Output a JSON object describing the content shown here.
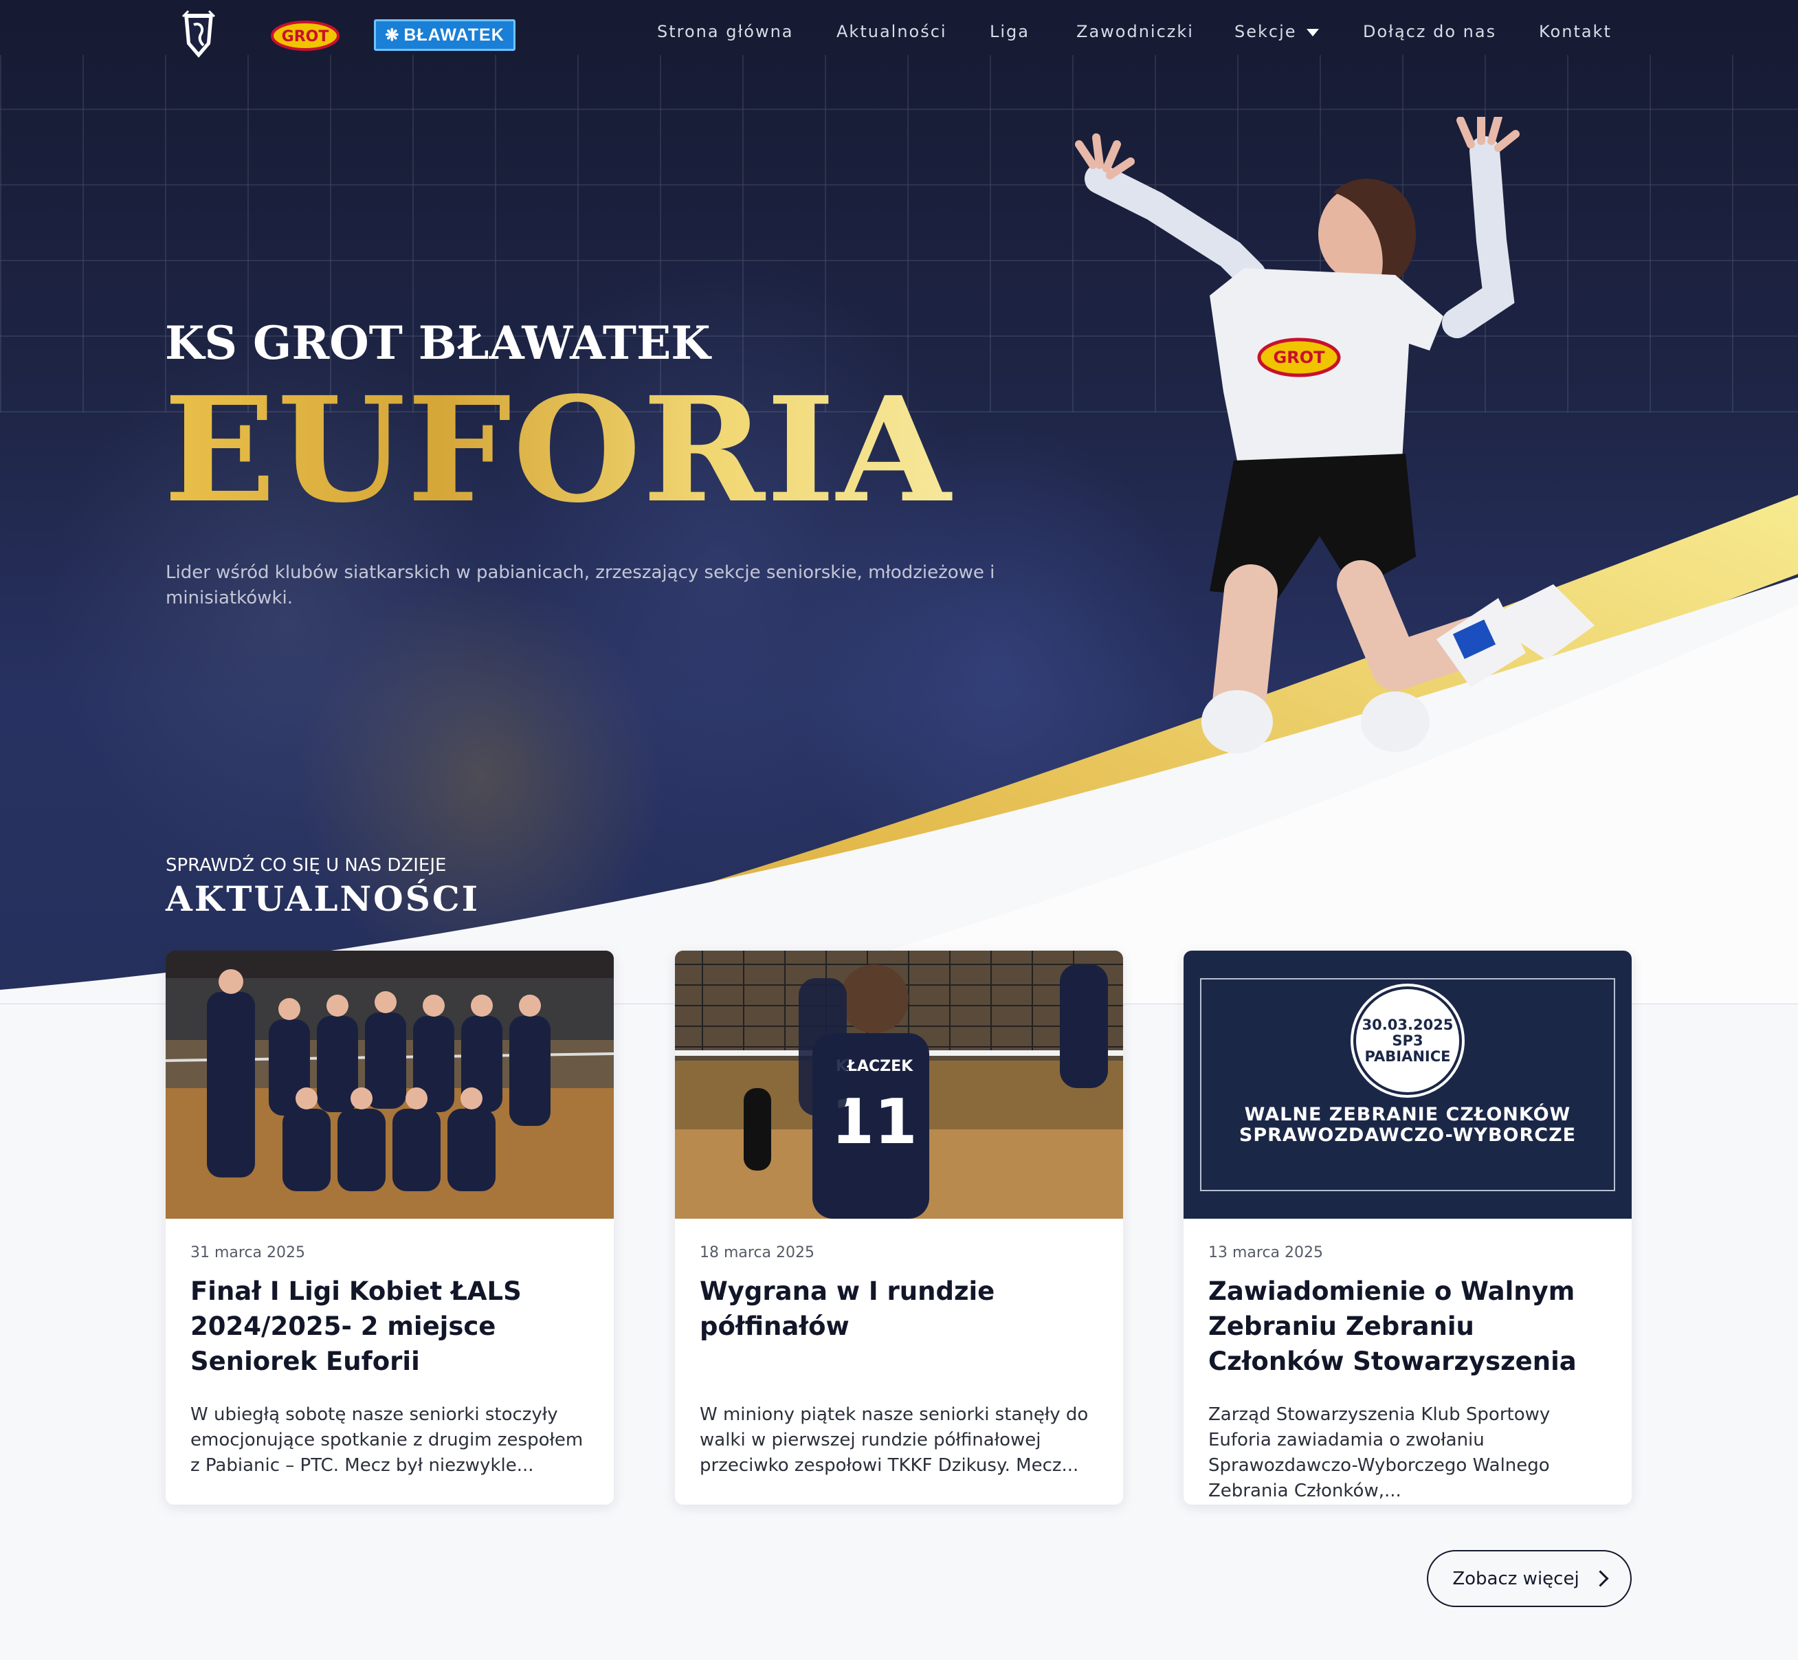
{
  "nav": {
    "logos": {
      "club": "club-crest-logo",
      "grot": "GROT",
      "blawatek": "BŁAWATEK"
    },
    "links": [
      {
        "label": "Strona główna"
      },
      {
        "label": "Aktualności"
      },
      {
        "label": "Liga"
      },
      {
        "label": "Zawodniczki"
      },
      {
        "label": "Sekcje"
      },
      {
        "label": "Dołącz do nas"
      },
      {
        "label": "Kontakt"
      }
    ]
  },
  "hero": {
    "subtitle": "KS GROT BŁAWATEK",
    "title": "EUFORIA",
    "description": "Lider wśród klubów siatkarskich w pabianicach, zrzeszający sekcje seniorskie, młodzieżowe i minisiatkówki."
  },
  "news": {
    "kicker": "SPRAWDŹ CO SIĘ U NAS DZIEJE",
    "heading": "AKTUALNOŚCI",
    "cards": [
      {
        "date": "31 marca 2025",
        "title": "Finał I Ligi Kobiet ŁALS 2024/2025- 2 miejsce Seniorek Euforii",
        "excerpt": "W ubiegłą sobotę nasze seniorki stoczyły emocjonujące spotkanie z drugim zespołem z Pabianic – PTC. Mecz był niezwykle..."
      },
      {
        "date": "18 marca 2025",
        "title": "Wygrana w I rundzie półfinałów",
        "excerpt": "W miniony piątek nasze seniorki stanęły do walki w pierwszej rundzie półfinałowej przeciwko zespołowi TKKF Dzikusy. Mecz...",
        "jersey_name": "KŁACZEK",
        "jersey_number": "11"
      },
      {
        "date": "13 marca 2025",
        "title": "Zawiadomienie o Walnym Zebraniu Zebraniu Członków Stowarzyszenia",
        "excerpt": "Zarząd Stowarzyszenia Klub Sportowy Euforia zawiadamia o zwołaniu Sprawozdawczo-Wyborczego Walnego Zebrania Członków,...",
        "badge_date": "30.03.2025",
        "badge_line2": "SP3",
        "badge_line3": "PABIANICE",
        "notice": "WALNE ZEBRANIE CZŁONKÓW SPRAWOZDAWCZO-WYBORCZE"
      }
    ],
    "more_label": "Zobacz więcej"
  },
  "colors": {
    "navy": "#1b2747",
    "gold": "#e2b64a",
    "gold_light": "#f6e79a",
    "background": "#f7f8fa"
  }
}
